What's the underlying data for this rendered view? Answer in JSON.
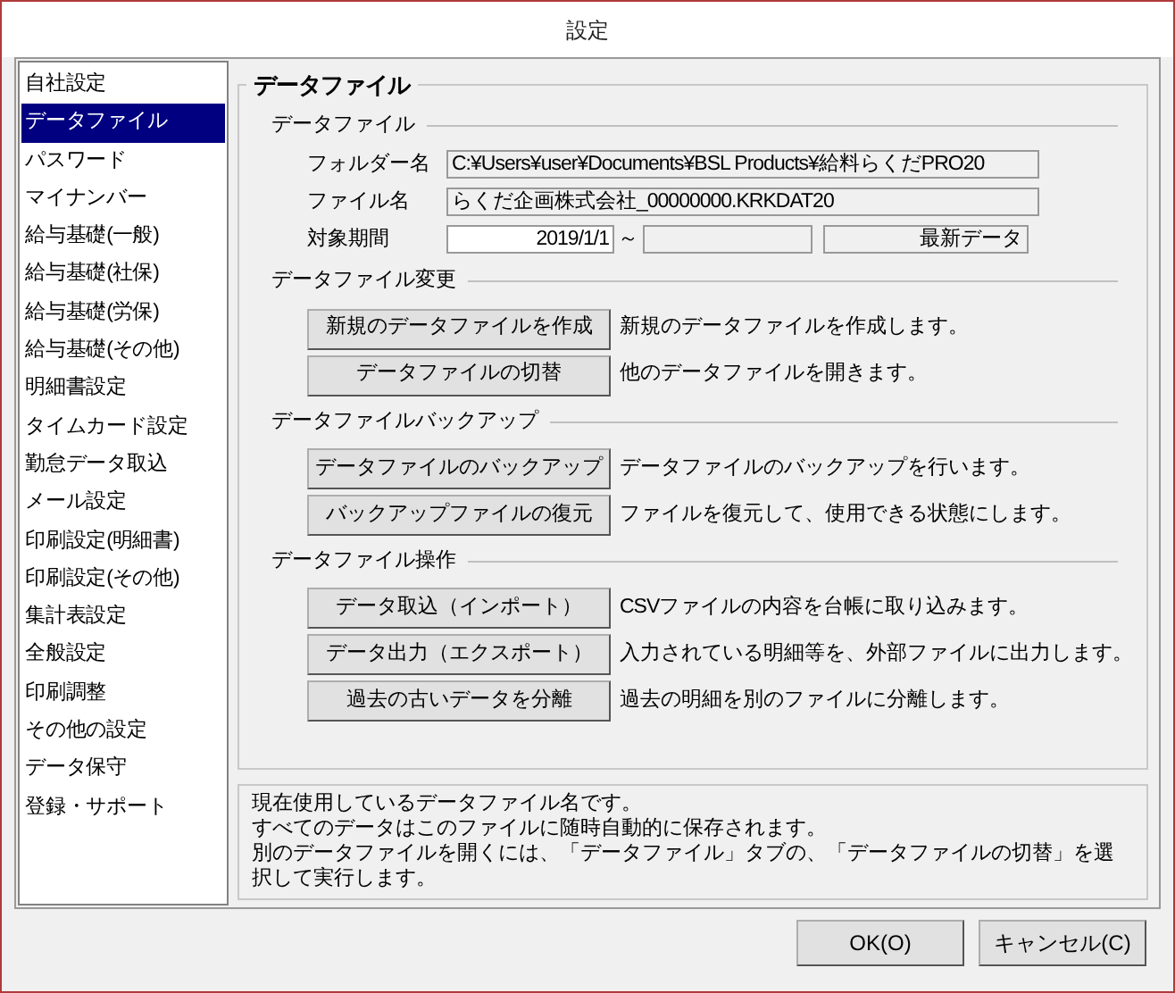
{
  "window": {
    "title": "設定"
  },
  "sidebar": {
    "items": [
      {
        "label": "自社設定",
        "selected": false
      },
      {
        "label": "データファイル",
        "selected": true
      },
      {
        "label": "パスワード",
        "selected": false
      },
      {
        "label": "マイナンバー",
        "selected": false
      },
      {
        "label": "給与基礎(一般)",
        "selected": false
      },
      {
        "label": "給与基礎(社保)",
        "selected": false
      },
      {
        "label": "給与基礎(労保)",
        "selected": false
      },
      {
        "label": "給与基礎(その他)",
        "selected": false
      },
      {
        "label": "明細書設定",
        "selected": false
      },
      {
        "label": "タイムカード設定",
        "selected": false
      },
      {
        "label": "勤怠データ取込",
        "selected": false
      },
      {
        "label": "メール設定",
        "selected": false
      },
      {
        "label": "印刷設定(明細書)",
        "selected": false
      },
      {
        "label": "印刷設定(その他)",
        "selected": false
      },
      {
        "label": "集計表設定",
        "selected": false
      },
      {
        "label": "全般設定",
        "selected": false
      },
      {
        "label": "印刷調整",
        "selected": false
      },
      {
        "label": "その他の設定",
        "selected": false
      },
      {
        "label": "データ保守",
        "selected": false
      },
      {
        "label": "登録・サポート",
        "selected": false
      }
    ]
  },
  "panel": {
    "title": "データファイル",
    "sections": [
      {
        "kind": "fields",
        "title": "データファイル",
        "fields": [
          {
            "label": "フォルダー名",
            "value": "C:¥Users¥user¥Documents¥BSL Products¥給料らくだPRO20"
          },
          {
            "label": "ファイル名",
            "value": "らくだ企画株式会社_00000000.KRKDAT20"
          }
        ],
        "period": {
          "label": "対象期間",
          "from": "2019/1/1",
          "separator": "～",
          "latest": "最新データ"
        }
      },
      {
        "kind": "actions",
        "title": "データファイル変更",
        "actions": [
          {
            "button": "新規のデータファイルを作成",
            "description": "新規のデータファイルを作成します。"
          },
          {
            "button": "データファイルの切替",
            "description": "他のデータファイルを開きます。"
          }
        ]
      },
      {
        "kind": "actions",
        "title": "データファイルバックアップ",
        "actions": [
          {
            "button": "データファイルのバックアップ",
            "description": "データファイルのバックアップを行います。"
          },
          {
            "button": "バックアップファイルの復元",
            "description": "ファイルを復元して、使用できる状態にします。"
          }
        ]
      },
      {
        "kind": "actions",
        "title": "データファイル操作",
        "actions": [
          {
            "button": "データ取込（インポート）",
            "description": "CSVファイルの内容を台帳に取り込みます。"
          },
          {
            "button": "データ出力（エクスポート）",
            "description": "入力されている明細等を、外部ファイルに出力します。"
          },
          {
            "button": "過去の古いデータを分離",
            "description": "過去の明細を別のファイルに分離します。"
          }
        ]
      }
    ]
  },
  "help_text": [
    "現在使用しているデータファイル名です。",
    "すべてのデータはこのファイルに随時自動的に保存されます。",
    "別のデータファイルを開くには、「データファイル」タブの、「データファイルの切替」を選択して実行します。"
  ],
  "buttons": [
    "OK(O)",
    "キャンセル(C)"
  ]
}
